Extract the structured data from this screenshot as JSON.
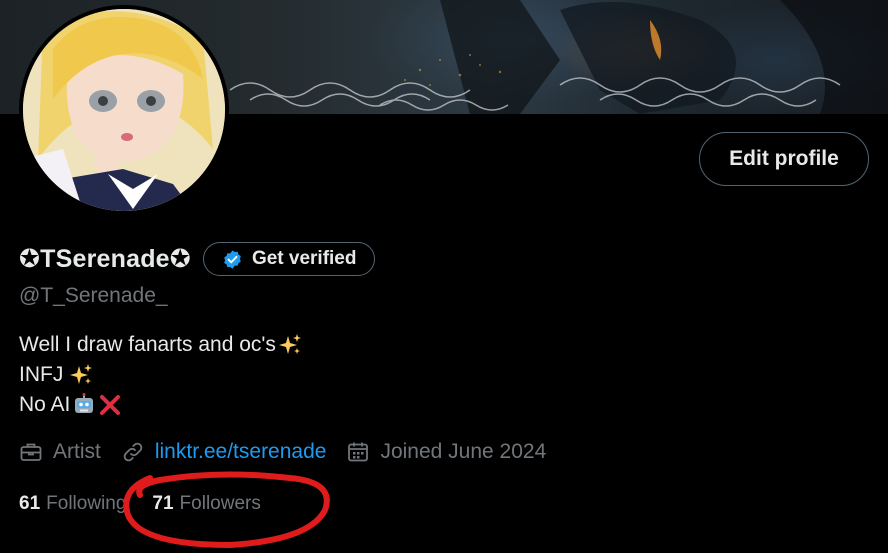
{
  "profile": {
    "display_name": "✪TSerenade✪",
    "handle": "@T_Serenade_",
    "edit_label": "Edit profile",
    "verify_label": "Get verified"
  },
  "bio": {
    "line1": "Well I draw fanarts and oc's",
    "line2": "INFJ",
    "line3": "No AI"
  },
  "meta": {
    "profession": "Artist",
    "link": "linktr.ee/tserenade",
    "joined": "Joined June 2024"
  },
  "stats": {
    "following_count": "61",
    "following_label": "Following",
    "followers_count": "71",
    "followers_label": "Followers"
  },
  "icons": {
    "verify": "verified-badge-icon",
    "profession": "briefcase-icon",
    "link": "link-icon",
    "calendar": "calendar-icon"
  },
  "colors": {
    "background": "#000000",
    "text_primary": "#e7e9ea",
    "text_secondary": "#71767b",
    "link": "#1d9bf0",
    "border": "#536471",
    "verify_badge": "#1d9bf0",
    "annotation": "#e01b1b"
  }
}
